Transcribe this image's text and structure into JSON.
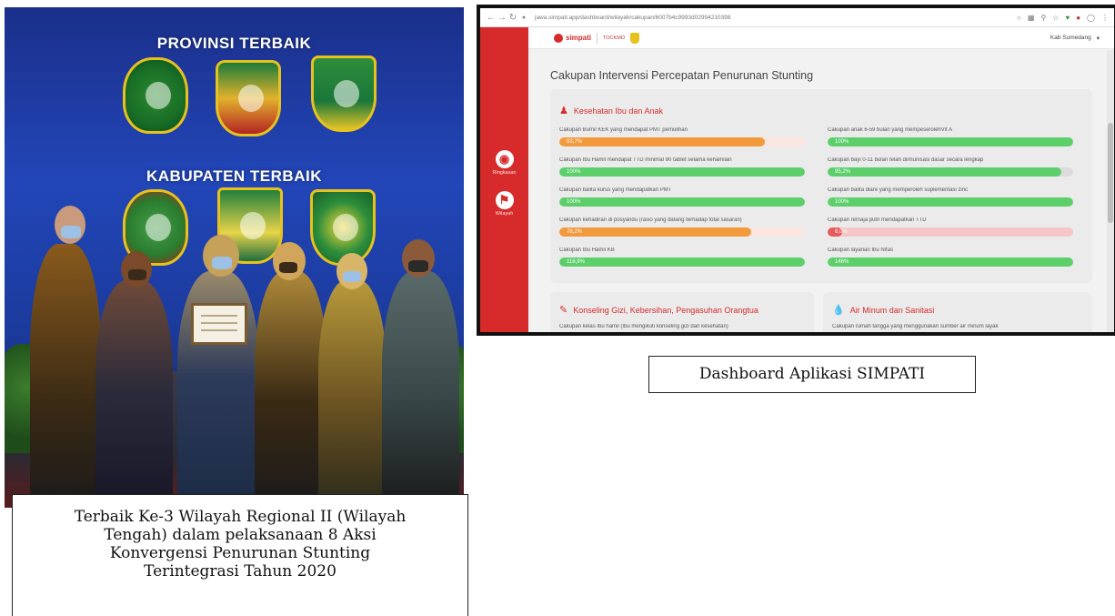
{
  "photo": {
    "heading_top": "PROVINSI TERBAIK",
    "heading_bottom": "KABUPATEN TERBAIK",
    "caption_lines": [
      "Terbaik Ke-3 Wilayah Regional II (Wilayah",
      "Tengah) dalam pelaksanaan 8 Aksi",
      "Konvergensi Penurunan Stunting",
      "Terintegrasi Tahun 2020"
    ]
  },
  "dashboard": {
    "browser": {
      "url": "jawa.simpati.app/dashboard/wilayah/cakupan/6007b4c9993d02994210398",
      "back_icon": "arrow-left-icon",
      "forward_icon": "arrow-right-icon",
      "reload_icon": "reload-icon"
    },
    "app": {
      "logo_text": "simpati",
      "partner_text": "TOCKMO",
      "user_menu": "Kab Sumedang"
    },
    "sidebar": [
      {
        "label": "Ringkasan",
        "icon": "gauge-icon"
      },
      {
        "label": "Wilayah",
        "icon": "map-pin-icon"
      }
    ],
    "page_title": "Cakupan Intervensi Percepatan Penurunan Stunting",
    "card_kia": {
      "title": "Kesehatan Ibu dan Anak",
      "metrics": [
        {
          "label": "Cakupan Bumil KEK yang mendapat PMT pemulihan",
          "value_text": "83,7%",
          "value": 83.7,
          "color": "#f39a3c",
          "track": "tinted"
        },
        {
          "label": "Cakupan anak 6-59 bulan yang mempeserolehVit A",
          "value_text": "100%",
          "value": 100,
          "color": "#5ccf6b",
          "track": "normal"
        },
        {
          "label": "Cakupan Ibu Hamil mendapat TTD minimal 90 tablet selama kehamilan",
          "value_text": "100%",
          "value": 100,
          "color": "#5ccf6b",
          "track": "normal"
        },
        {
          "label": "Cakupan bayi 0-11 bulan telah diimunisasi dasar secara lengkap",
          "value_text": "95,2%",
          "value": 95.2,
          "color": "#5ccf6b",
          "track": "normal"
        },
        {
          "label": "Cakupan balita kurus yang mendapatkan PMT",
          "value_text": "100%",
          "value": 100,
          "color": "#5ccf6b",
          "track": "normal"
        },
        {
          "label": "Cakupan balita diare yang memperoleh suplementasi zinc",
          "value_text": "100%",
          "value": 100,
          "color": "#5ccf6b",
          "track": "normal"
        },
        {
          "label": "Cakupan kehadiran di posyandu (rasio yang datang terhadap total sasaran)",
          "value_text": "78,2%",
          "value": 78.2,
          "color": "#f39a3c",
          "track": "tinted"
        },
        {
          "label": "Cakupan remaja putri mendapatkan TTD",
          "value_text": "6,0%",
          "value": 6,
          "color": "#e65b5b",
          "track": "pink"
        },
        {
          "label": "Cakupan Ibu Hamil KB",
          "value_text": "118,9%",
          "value": 100,
          "color": "#5ccf6b",
          "track": "normal"
        },
        {
          "label": "Cakupan layanan Ibu Nifas",
          "value_text": "146%",
          "value": 100,
          "color": "#5ccf6b",
          "track": "normal"
        }
      ]
    },
    "card_gizi": {
      "title": "Konseling Gizi, Kebersihan, Pengasuhan Orangtua",
      "first_label": "Cakupan kelas Ibu hamil (Ibu mengikuti konseling gizi dan kesehatan)"
    },
    "card_air": {
      "title": "Air Minum dan Sanitasi",
      "first_label": "Cakupan rumah tangga yang menggunakan sumber air minum layak"
    },
    "colors": {
      "brand_red": "#d72b2b",
      "green": "#5ccf6b",
      "orange": "#f39a3c",
      "red": "#e65b5b"
    }
  },
  "dashboard_caption": "Dashboard Aplikasi SIMPATI"
}
